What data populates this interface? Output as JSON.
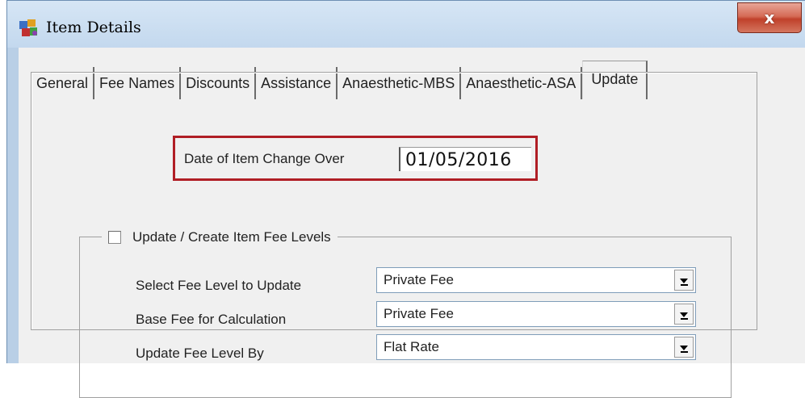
{
  "window": {
    "title": "Item Details",
    "close_label": "x"
  },
  "tabs": [
    {
      "label": "General"
    },
    {
      "label": "Fee Names"
    },
    {
      "label": "Discounts"
    },
    {
      "label": "Assistance"
    },
    {
      "label": "Anaesthetic-MBS"
    },
    {
      "label": "Anaesthetic-ASA"
    },
    {
      "label": "Update",
      "active": true
    }
  ],
  "update": {
    "date_label": "Date of Item Change Over",
    "date_value": "01/05/2016",
    "highlight_color": "#b01e25",
    "group_label": "Update / Create Item Fee Levels",
    "group_checked": false,
    "fields": [
      {
        "label": "Select Fee Level to Update",
        "value": "Private Fee"
      },
      {
        "label": "Base Fee for Calculation",
        "value": "Private Fee"
      },
      {
        "label": "Update Fee Level By",
        "value": "Flat Rate"
      }
    ]
  }
}
